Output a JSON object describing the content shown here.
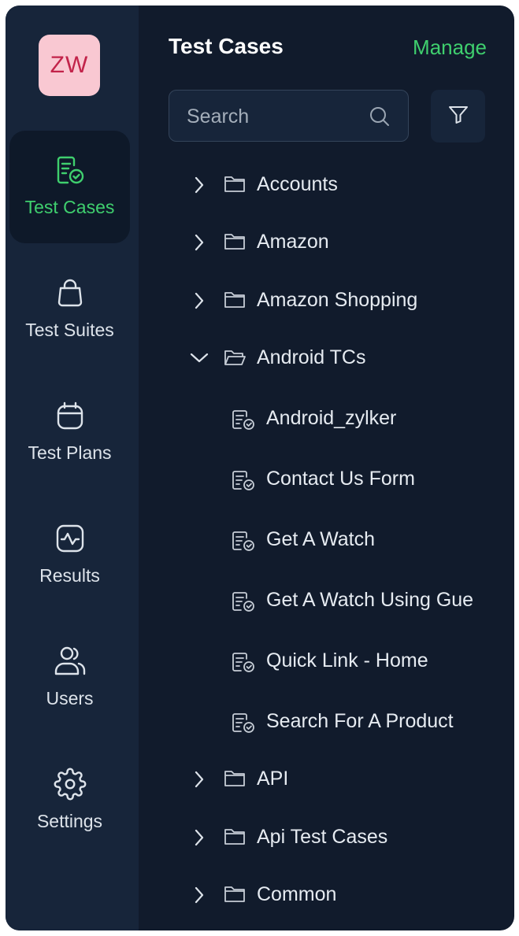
{
  "app": {
    "avatar_initials": "ZW"
  },
  "sidebar": {
    "items": [
      {
        "label": "Test Cases",
        "icon": "test-case-icon",
        "active": true
      },
      {
        "label": "Test Suites",
        "icon": "suite-bag-icon",
        "active": false
      },
      {
        "label": "Test Plans",
        "icon": "calendar-icon",
        "active": false
      },
      {
        "label": "Results",
        "icon": "pulse-chart-icon",
        "active": false
      },
      {
        "label": "Users",
        "icon": "users-icon",
        "active": false
      },
      {
        "label": "Settings",
        "icon": "gear-icon",
        "active": false
      }
    ]
  },
  "panel": {
    "title": "Test Cases",
    "manage_label": "Manage",
    "search_placeholder": "Search"
  },
  "tree": [
    {
      "label": "Accounts",
      "type": "folder",
      "expanded": false
    },
    {
      "label": "Amazon",
      "type": "folder",
      "expanded": false
    },
    {
      "label": "Amazon Shopping",
      "type": "folder",
      "expanded": false
    },
    {
      "label": "Android TCs",
      "type": "folder",
      "expanded": true
    },
    {
      "label": "Android_zylker",
      "type": "case"
    },
    {
      "label": "Contact Us Form",
      "type": "case"
    },
    {
      "label": "Get A Watch",
      "type": "case"
    },
    {
      "label": "Get A Watch Using Gue",
      "type": "case"
    },
    {
      "label": "Quick Link - Home",
      "type": "case"
    },
    {
      "label": "Search For A Product",
      "type": "case"
    },
    {
      "label": "API",
      "type": "folder",
      "expanded": false
    },
    {
      "label": "Api Test Cases",
      "type": "folder",
      "expanded": false
    },
    {
      "label": "Common",
      "type": "folder",
      "expanded": false
    }
  ],
  "colors": {
    "background": "#111b2c",
    "sidebar": "#17253a",
    "accent": "#3fcf6e",
    "avatar_bg": "#f9c8d2",
    "avatar_text": "#c2234a"
  }
}
